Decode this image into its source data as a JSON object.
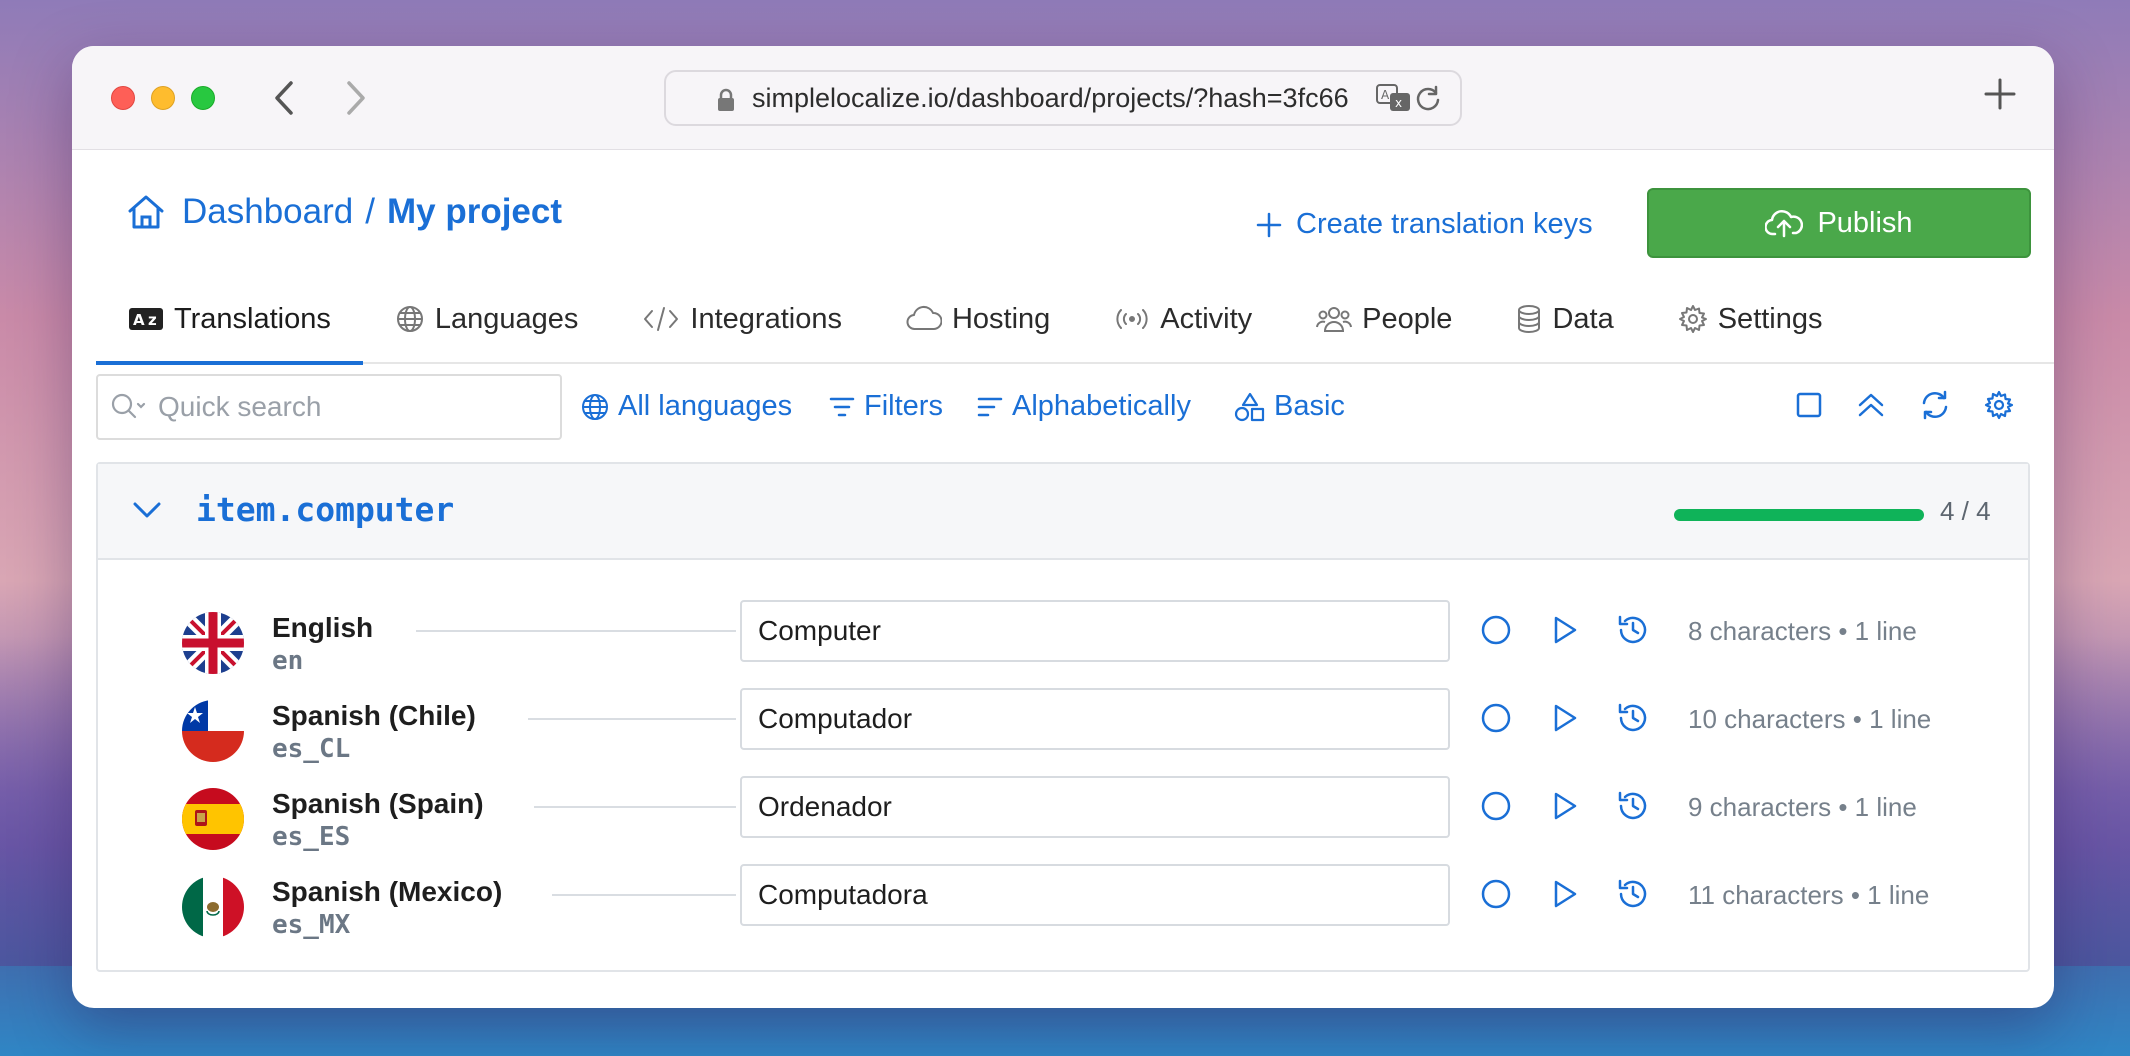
{
  "browser": {
    "url": "simplelocalize.io/dashboard/projects/?hash=3fc66"
  },
  "header": {
    "breadcrumb_root": "Dashboard",
    "breadcrumb_sep": "/",
    "project_name": "My project",
    "create_keys_label": "Create translation keys",
    "publish_label": "Publish"
  },
  "tabs": [
    {
      "label": "Translations",
      "icon": "translate-box-icon",
      "active": true
    },
    {
      "label": "Languages",
      "icon": "globe-icon"
    },
    {
      "label": "Integrations",
      "icon": "code-icon"
    },
    {
      "label": "Hosting",
      "icon": "cloud-icon"
    },
    {
      "label": "Activity",
      "icon": "broadcast-icon"
    },
    {
      "label": "People",
      "icon": "people-icon"
    },
    {
      "label": "Data",
      "icon": "database-icon"
    },
    {
      "label": "Settings",
      "icon": "gear-icon"
    }
  ],
  "toolbar": {
    "search_placeholder": "Quick search",
    "languages_label": "All languages",
    "filters_label": "Filters",
    "sort_label": "Alphabetically",
    "view_label": "Basic"
  },
  "key": {
    "name": "item.computer",
    "progress_text": "4 / 4",
    "progress_fraction": 1.0,
    "progress_color": "#0fb359"
  },
  "translations": [
    {
      "language": "English",
      "code": "en",
      "value": "Computer",
      "chars": "8 characters",
      "lines": "1 line"
    },
    {
      "language": "Spanish (Chile)",
      "code": "es_CL",
      "value": "Computador",
      "chars": "10 characters",
      "lines": "1 line"
    },
    {
      "language": "Spanish (Spain)",
      "code": "es_ES",
      "value": "Ordenador",
      "chars": "9 characters",
      "lines": "1 line"
    },
    {
      "language": "Spanish (Mexico)",
      "code": "es_MX",
      "value": "Computadora",
      "chars": "11 characters",
      "lines": "1 line"
    }
  ],
  "meta_separator": "•",
  "colors": {
    "accent": "#1a6fd6",
    "publish": "#4aa84a"
  }
}
